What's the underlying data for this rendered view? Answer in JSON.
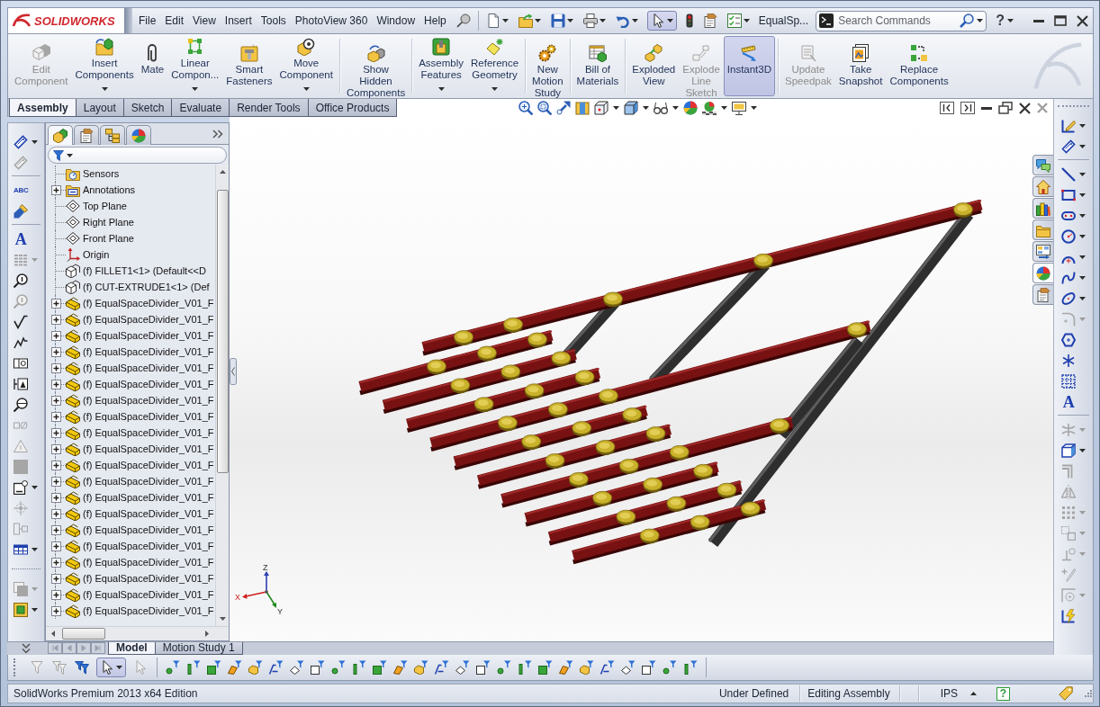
{
  "app_bar": {
    "logo": "SOLIDWORKS",
    "menu": [
      "File",
      "Edit",
      "View",
      "Insert",
      "Tools",
      "PhotoView 360",
      "Window",
      "Help"
    ],
    "quick_access": [
      {
        "dropdown": true,
        "pressed": false
      },
      {
        "dropdown": true,
        "pressed": false
      },
      {
        "dropdown": true,
        "pressed": false
      },
      {
        "dropdown": true,
        "pressed": false
      },
      {
        "dropdown": true,
        "pressed": false
      },
      {
        "dropdown": true,
        "pressed": true
      },
      {
        "dropdown": false,
        "pressed": false
      },
      {
        "dropdown": false,
        "pressed": false
      },
      {
        "dropdown": true,
        "pressed": false
      }
    ],
    "document_title": "EqualSp...",
    "search": {
      "placeholder": "Search Commands"
    },
    "help": {
      "glyph": "?"
    }
  },
  "command_manager": {
    "buttons": [
      {
        "label": "Edit\nComponent",
        "disabled": true,
        "dropdown": false,
        "pressed": false
      },
      {
        "label": "Insert\nComponents",
        "disabled": false,
        "dropdown": true,
        "pressed": false
      },
      {
        "label": "Mate",
        "disabled": false,
        "dropdown": false,
        "pressed": false
      },
      {
        "label": "Linear\nCompon...",
        "disabled": false,
        "dropdown": true,
        "pressed": false
      },
      {
        "label": "Smart\nFasteners",
        "disabled": false,
        "dropdown": false,
        "pressed": false
      },
      {
        "label": "Move\nComponent",
        "disabled": false,
        "dropdown": true,
        "pressed": false
      },
      {
        "label": "Show\nHidden\nComponents",
        "disabled": false,
        "dropdown": false,
        "pressed": false
      },
      {
        "label": "Assembly\nFeatures",
        "disabled": false,
        "dropdown": true,
        "pressed": false
      },
      {
        "label": "Reference\nGeometry",
        "disabled": false,
        "dropdown": true,
        "pressed": false
      },
      {
        "label": "New\nMotion\nStudy",
        "disabled": false,
        "dropdown": false,
        "pressed": false
      },
      {
        "label": "Bill of\nMaterials",
        "disabled": false,
        "dropdown": false,
        "pressed": false
      },
      {
        "label": "Exploded\nView",
        "disabled": false,
        "dropdown": false,
        "pressed": false
      },
      {
        "label": "Explode\nLine\nSketch",
        "disabled": true,
        "dropdown": false,
        "pressed": false
      },
      {
        "label": "Instant3D",
        "disabled": false,
        "dropdown": false,
        "pressed": true
      },
      {
        "label": "Update\nSpeedpak",
        "disabled": true,
        "dropdown": false,
        "pressed": false
      },
      {
        "label": "Take\nSnapshot",
        "disabled": false,
        "dropdown": false,
        "pressed": false
      },
      {
        "label": "Replace\nComponents",
        "disabled": false,
        "dropdown": false,
        "pressed": false
      }
    ],
    "tabs": [
      {
        "label": "Assembly",
        "selected": true
      },
      {
        "label": "Layout",
        "selected": false
      },
      {
        "label": "Sketch",
        "selected": false
      },
      {
        "label": "Evaluate",
        "selected": false
      },
      {
        "label": "Render Tools",
        "selected": false
      },
      {
        "label": "Office Products",
        "selected": false
      }
    ]
  },
  "left_toolbar": {
    "items": [
      {
        "disabled": false,
        "dropdown": true
      },
      {
        "disabled": true,
        "dropdown": false
      },
      {
        "disabled": false,
        "dropdown": false,
        "glyph": "ABC"
      },
      {
        "disabled": false,
        "dropdown": false
      },
      {
        "disabled": false,
        "dropdown": false,
        "glyph": "A"
      },
      {
        "disabled": true,
        "dropdown": true
      },
      {
        "disabled": false,
        "dropdown": false
      },
      {
        "disabled": true,
        "dropdown": false
      },
      {
        "disabled": false,
        "dropdown": false
      },
      {
        "disabled": false,
        "dropdown": false
      },
      {
        "disabled": false,
        "dropdown": false
      },
      {
        "disabled": false,
        "dropdown": false
      },
      {
        "disabled": false,
        "dropdown": false
      },
      {
        "disabled": true,
        "dropdown": false
      },
      {
        "disabled": true,
        "dropdown": false
      },
      {
        "disabled": true,
        "dropdown": false
      },
      {
        "disabled": false,
        "dropdown": true
      },
      {
        "disabled": true,
        "dropdown": false
      },
      {
        "disabled": true,
        "dropdown": false
      },
      {
        "disabled": false,
        "dropdown": true
      },
      {
        "disabled": true,
        "dropdown": true
      },
      {
        "disabled": false,
        "dropdown": true
      }
    ]
  },
  "feature_manager": {
    "tabs": [
      {
        "selected": true
      },
      {
        "selected": false
      },
      {
        "selected": false
      },
      {
        "selected": false
      }
    ],
    "tree": [
      {
        "kind": "sensors",
        "label": "Sensors",
        "collapsible": false
      },
      {
        "kind": "annotations",
        "label": "Annotations",
        "collapsible": true,
        "expanded": false
      },
      {
        "kind": "plane",
        "label": "Top Plane",
        "collapsible": false
      },
      {
        "kind": "plane",
        "label": "Right Plane",
        "collapsible": false
      },
      {
        "kind": "plane",
        "label": "Front Plane",
        "collapsible": false
      },
      {
        "kind": "origin",
        "label": "Origin",
        "collapsible": false
      },
      {
        "kind": "part",
        "label": "(f) FILLET1<1> (Default<<D",
        "collapsible": false
      },
      {
        "kind": "part",
        "label": "(f) CUT-EXTRUDE1<1> (Def",
        "collapsible": false
      },
      {
        "kind": "component",
        "label": "(f) EqualSpaceDivider_V01_F",
        "collapsible": true,
        "expanded": false
      },
      {
        "kind": "component",
        "label": "(f) EqualSpaceDivider_V01_F",
        "collapsible": true,
        "expanded": false
      },
      {
        "kind": "component",
        "label": "(f) EqualSpaceDivider_V01_F",
        "collapsible": true,
        "expanded": false
      },
      {
        "kind": "component",
        "label": "(f) EqualSpaceDivider_V01_F",
        "collapsible": true,
        "expanded": false
      },
      {
        "kind": "component",
        "label": "(f) EqualSpaceDivider_V01_F",
        "collapsible": true,
        "expanded": false
      },
      {
        "kind": "component",
        "label": "(f) EqualSpaceDivider_V01_F",
        "collapsible": true,
        "expanded": false
      },
      {
        "kind": "component",
        "label": "(f) EqualSpaceDivider_V01_F",
        "collapsible": true,
        "expanded": false
      },
      {
        "kind": "component",
        "label": "(f) EqualSpaceDivider_V01_F",
        "collapsible": true,
        "expanded": false
      },
      {
        "kind": "component",
        "label": "(f) EqualSpaceDivider_V01_F",
        "collapsible": true,
        "expanded": false
      },
      {
        "kind": "component",
        "label": "(f) EqualSpaceDivider_V01_F",
        "collapsible": true,
        "expanded": false
      },
      {
        "kind": "component",
        "label": "(f) EqualSpaceDivider_V01_F",
        "collapsible": true,
        "expanded": false
      },
      {
        "kind": "component",
        "label": "(f) EqualSpaceDivider_V01_F",
        "collapsible": true,
        "expanded": false
      },
      {
        "kind": "component",
        "label": "(f) EqualSpaceDivider_V01_F",
        "collapsible": true,
        "expanded": false
      },
      {
        "kind": "component",
        "label": "(f) EqualSpaceDivider_V01_F",
        "collapsible": true,
        "expanded": false
      },
      {
        "kind": "component",
        "label": "(f) EqualSpaceDivider_V01_F",
        "collapsible": true,
        "expanded": false
      },
      {
        "kind": "component",
        "label": "(f) EqualSpaceDivider_V01_F",
        "collapsible": true,
        "expanded": false
      },
      {
        "kind": "component",
        "label": "(f) EqualSpaceDivider_V01_F",
        "collapsible": true,
        "expanded": false
      },
      {
        "kind": "component",
        "label": "(f) EqualSpaceDivider_V01_F",
        "collapsible": true,
        "expanded": false
      },
      {
        "kind": "component",
        "label": "(f) EqualSpaceDivider_V01_F",
        "collapsible": true,
        "expanded": false
      },
      {
        "kind": "component",
        "label": "(f) EqualSpaceDivider_V01_F",
        "collapsible": true,
        "expanded": false
      }
    ]
  },
  "viewport": {
    "triad": {
      "x": "X",
      "y": "Y",
      "z": "Z"
    }
  },
  "task_pane": {
    "tabs": [
      {
        "selected": false
      },
      {
        "selected": false
      },
      {
        "selected": false
      },
      {
        "selected": false
      },
      {
        "selected": false
      },
      {
        "selected": true
      },
      {
        "selected": false
      }
    ]
  },
  "right_toolbar": {
    "items": [
      {
        "disabled": false,
        "dropdown": true
      },
      {
        "disabled": false,
        "dropdown": true
      },
      {
        "disabled": false,
        "dropdown": true
      },
      {
        "disabled": false,
        "dropdown": true
      },
      {
        "disabled": false,
        "dropdown": true
      },
      {
        "disabled": false,
        "dropdown": true
      },
      {
        "disabled": false,
        "dropdown": true
      },
      {
        "disabled": false,
        "dropdown": true
      },
      {
        "disabled": false,
        "dropdown": true
      },
      {
        "disabled": true,
        "dropdown": true
      },
      {
        "disabled": false,
        "dropdown": false
      },
      {
        "disabled": false,
        "dropdown": false
      },
      {
        "disabled": false,
        "dropdown": false
      },
      {
        "disabled": false,
        "dropdown": false,
        "glyph": "A"
      },
      {
        "disabled": true,
        "dropdown": true
      },
      {
        "disabled": false,
        "dropdown": true
      },
      {
        "disabled": true,
        "dropdown": false
      },
      {
        "disabled": true,
        "dropdown": false
      },
      {
        "disabled": true,
        "dropdown": true
      },
      {
        "disabled": true,
        "dropdown": true
      },
      {
        "disabled": true,
        "dropdown": true
      },
      {
        "disabled": true,
        "dropdown": false
      },
      {
        "disabled": true,
        "dropdown": true
      },
      {
        "disabled": false,
        "dropdown": false
      }
    ]
  },
  "bottom_tabs": [
    {
      "label": "Model",
      "selected": true
    },
    {
      "label": "Motion Study 1",
      "selected": false
    }
  ],
  "selection_filter": {
    "tools": [
      {
        "disabled": true,
        "pressed": false,
        "dropdown": false
      },
      {
        "disabled": true,
        "pressed": false,
        "dropdown": false
      },
      {
        "disabled": false,
        "pressed": false,
        "dropdown": false
      },
      {
        "disabled": false,
        "pressed": true,
        "dropdown": true
      },
      {
        "disabled": true,
        "pressed": false,
        "dropdown": false
      }
    ]
  },
  "status_bar": {
    "edition": "SolidWorks Premium 2013 x64 Edition",
    "sketch_state": "Under Defined",
    "mode": "Editing Assembly",
    "units": "IPS",
    "help": {
      "glyph": "?"
    }
  }
}
